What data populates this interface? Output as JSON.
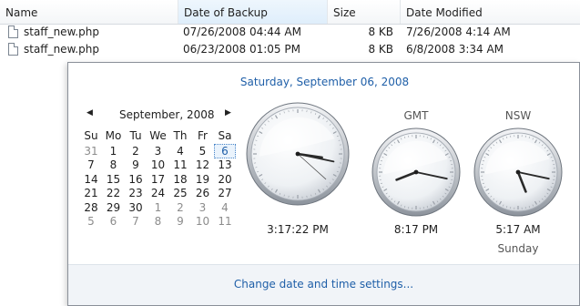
{
  "file_list": {
    "columns": [
      "Name",
      "Date of Backup",
      "Size",
      "Date Modified"
    ],
    "rows": [
      {
        "name": "staff_new.php",
        "backup": "07/26/2008 04:44 AM",
        "size": "8 KB",
        "modified": "7/26/2008 4:14 AM"
      },
      {
        "name": "staff_new.php",
        "backup": "06/23/2008 01:05 PM",
        "size": "8 KB",
        "modified": "6/8/2008 3:34 AM"
      }
    ]
  },
  "flyout": {
    "date_header": "Saturday, September 06, 2008",
    "calendar": {
      "month_label": "September, 2008",
      "prev_glyph": "◀",
      "next_glyph": "▶",
      "day_headers": [
        "Su",
        "Mo",
        "Tu",
        "We",
        "Th",
        "Fr",
        "Sa"
      ],
      "weeks": [
        [
          "31",
          "1",
          "2",
          "3",
          "4",
          "5",
          "6"
        ],
        [
          "7",
          "8",
          "9",
          "10",
          "11",
          "12",
          "13"
        ],
        [
          "14",
          "15",
          "16",
          "17",
          "18",
          "19",
          "20"
        ],
        [
          "21",
          "22",
          "23",
          "24",
          "25",
          "26",
          "27"
        ],
        [
          "28",
          "29",
          "30",
          "1",
          "2",
          "3",
          "4"
        ],
        [
          "5",
          "6",
          "7",
          "8",
          "9",
          "10",
          "11"
        ]
      ],
      "selected_day": "6"
    },
    "clocks": [
      {
        "label": "",
        "time": "3:17:22 PM",
        "hour": 3,
        "minute": 17,
        "second": 22,
        "sub": ""
      },
      {
        "label": "GMT",
        "time": "8:17 PM",
        "hour": 8,
        "minute": 17,
        "sub": ""
      },
      {
        "label": "NSW",
        "time": "5:17 AM",
        "hour": 5,
        "minute": 17,
        "sub": "Sunday"
      }
    ],
    "settings_link": "Change date and time settings..."
  }
}
